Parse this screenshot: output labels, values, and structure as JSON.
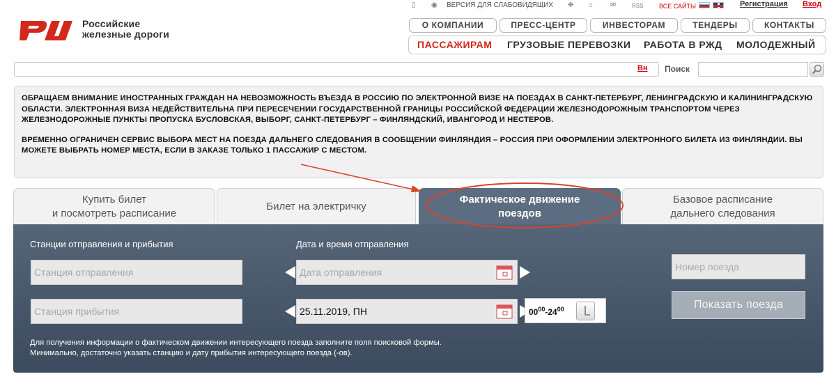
{
  "header": {
    "logo_line1": "Российские",
    "logo_line2": "железные дороги"
  },
  "util_bar": {
    "vision_label": "ВЕРСИЯ ДЛЯ СЛАБОВИДЯЩИХ",
    "rss": "RSS",
    "all_sites": "ВСЕ САЙТЫ",
    "register": "Регистрация",
    "login": "Вход"
  },
  "top_nav": [
    "О КОМПАНИИ",
    "ПРЕСС-ЦЕНТР",
    "ИНВЕСТОРАМ",
    "ТЕНДЕРЫ",
    "КОНТАКТЫ"
  ],
  "main_nav": [
    "ПАССАЖИРАМ",
    "ГРУЗОВЫЕ ПЕРЕВОЗКИ",
    "РАБОТА В РЖД",
    "МОЛОДЕЖНЫЙ"
  ],
  "search": {
    "lang_link": "Вн",
    "label": "Поиск",
    "value": ""
  },
  "notice": {
    "paragraph1": "ОБРАЩАЕМ ВНИМАНИЕ ИНОСТРАННЫХ ГРАЖДАН НА НЕВОЗМОЖНОСТЬ ВЪЕЗДА В РОССИЮ ПО ЭЛЕКТРОННОЙ ВИЗЕ НА ПОЕЗДАХ В САНКТ-ПЕТЕРБУРГ, ЛЕНИНГРАДСКУЮ И КАЛИНИНГРАДСКУЮ ОБЛАСТИ. ЭЛЕКТРОННАЯ ВИЗА НЕДЕЙСТВИТЕЛЬНА ПРИ ПЕРЕСЕЧЕНИИ ГОСУДАРСТВЕННОЙ ГРАНИЦЫ РОССИЙСКОЙ ФЕДЕРАЦИИ ЖЕЛЕЗНОДОРОЖНЫМ ТРАНСПОРТОМ ЧЕРЕЗ ЖЕЛЕЗНОДОРОЖНЫЕ ПУНКТЫ ПРОПУСКА БУСЛОВСКАЯ, ВЫБОРГ, САНКТ-ПЕТЕРБУРГ – ФИНЛЯНДСКИЙ, ИВАНГОРОД И НЕСТЕРОВ.",
    "paragraph2": "ВРЕМЕННО ОГРАНИЧЕН СЕРВИС ВЫБОРА МЕСТ НА ПОЕЗДА ДАЛЬНЕГО СЛЕДОВАНИЯ В СООБЩЕНИИ ФИНЛЯНДИЯ – РОССИЯ ПРИ ОФОРМЛЕНИИ ЭЛЕКТРОННОГО БИЛЕТА ИЗ ФИНЛЯНДИИ. ВЫ МОЖЕТЕ ВЫБРАТЬ НОМЕР МЕСТА, ЕСЛИ В ЗАКАЗЕ ТОЛЬКО 1 ПАССАЖИР С МЕСТОМ."
  },
  "tabs": {
    "buy_line1": "Купить билет",
    "buy_line2": "и посмотреть расписание",
    "suburban": "Билет на электричку",
    "actual_line1": "Фактическое движение",
    "actual_line2": "поездов",
    "schedule_line1": "Базовое расписание",
    "schedule_line2": "дальнего следования"
  },
  "panel": {
    "stations_label": "Станции отправления и прибытия",
    "datetime_label": "Дата и время отправления",
    "departure_placeholder": "Станция отправления",
    "arrival_placeholder": "Станция прибытия",
    "date_placeholder": "Дата отправления",
    "date_value": "25.11.2019, ПН",
    "time_from": "00",
    "time_from_sup": "00",
    "time_sep": "-",
    "time_to": "24",
    "time_to_sup": "00",
    "train_number_placeholder": "Номер поезда",
    "show_button": "Показать поезда",
    "hint_line1": "Для получения информации о фактическом движении интересующего поезда заполните поля поисковой формы.",
    "hint_line2": "Минимально, достаточно указать станцию и дату прибытия интересующего поезда (-ов)."
  },
  "colors": {
    "brand_red": "#d3281c",
    "panel_blue": "#5d6d81",
    "annotation_red": "#d8442c"
  }
}
